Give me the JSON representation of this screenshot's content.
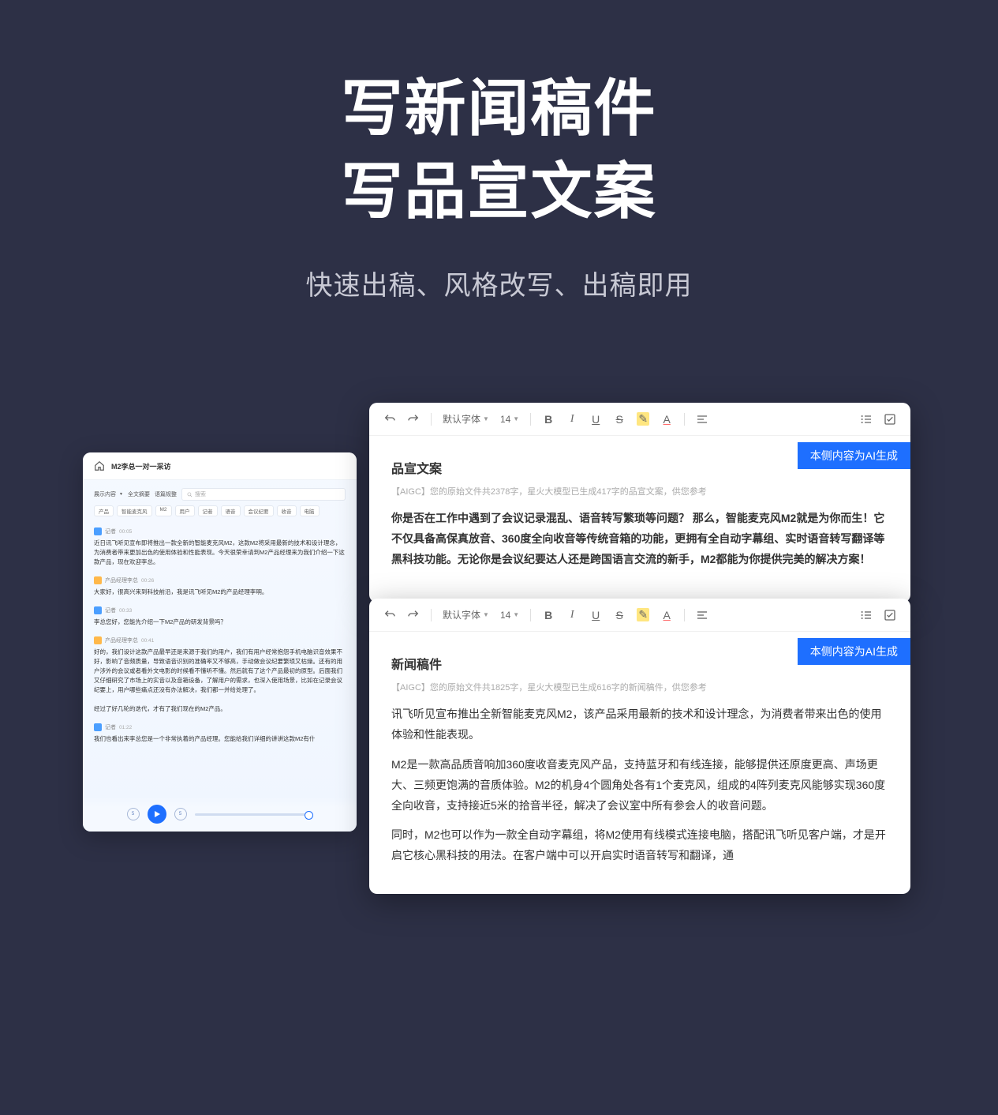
{
  "hero": {
    "title_line1": "写新闻稿件",
    "title_line2": "写品宣文案",
    "subtitle": "快速出稿、风格改写、出稿即用"
  },
  "transcript": {
    "title": "M2李总一对一采访",
    "tabs": [
      "展示内容",
      "全文摘要",
      "语篇规整"
    ],
    "search_placeholder": "搜索",
    "tags": [
      "产品",
      "智能麦克风",
      "M2",
      "用户",
      "记者",
      "语音",
      "会议纪要",
      "收音",
      "电脑"
    ],
    "messages": [
      {
        "speaker": "记者",
        "time": "00:05",
        "avatar": "a1",
        "text": "近日讯飞听见宣布即将推出一款全新的智能麦克风M2，这款M2将采用最新的技术和设计理念，为消费者带来更加出色的使用体验和性能表现。今天很荣幸请到M2产品经理来为我们介绍一下这款产品，现在欢迎李总。"
      },
      {
        "speaker": "产品经理李总",
        "time": "00:26",
        "avatar": "a2",
        "text": "大家好，很高兴来到科技前沿，我是讯飞听见M2的产品经理李明。"
      },
      {
        "speaker": "记者",
        "time": "00:33",
        "avatar": "a1",
        "text": "李总您好，您能先介绍一下M2产品的研发背景吗？"
      },
      {
        "speaker": "产品经理李总",
        "time": "00:41",
        "avatar": "a2",
        "text": "好的，我们设计这款产品最早还是来源于我们的用户，我们有用户经常抱怨手机电脑识音效果不好，影响了音频质量，导致语音识别的准确率又不够高，手动做会议纪要繁琐又枯燥。还有的用户涉外的会议或者看外文电影的时候看不懂听不懂。然后就有了这个产品最初的原型。后面我们又仔细研究了市场上的实音以及音箱设备，了解用户的需求，也深入使用场景，比如在记录会议纪要上，用户哪些痛点还没有办法解决，我们都一并给处理了。"
      },
      {
        "speaker": "",
        "time": "",
        "avatar": "",
        "text": "经过了好几轮的迭代，才有了我们现在的M2产品。"
      },
      {
        "speaker": "记者",
        "time": "01:22",
        "avatar": "a1",
        "text": "我们也看出来李总您是一个非常执着的产品经理。您能给我们详细的讲讲这款M2有什"
      }
    ],
    "skip_label": "5"
  },
  "toolbar": {
    "font": "默认字体",
    "size": "14"
  },
  "panels": [
    {
      "badge": "本侧内容为AI生成",
      "title": "品宣文案",
      "meta": "【AIGC】您的原始文件共2378字，星火大模型已生成417字的品宣文案，供您参考",
      "paragraphs": [
        {
          "bold": true,
          "text": "你是否在工作中遇到了会议记录混乱、语音转写繁琐等问题？ 那么，智能麦克风M2就是为你而生！它不仅具备高保真放音、360度全向收音等传统音箱的功能，更拥有全自动字幕组、实时语音转写翻译等黑科技功能。无论你是会议纪要达人还是跨国语言交流的新手，M2都能为你提供完美的解决方案！"
        }
      ]
    },
    {
      "badge": "本侧内容为AI生成",
      "title": "新闻稿件",
      "meta": "【AIGC】您的原始文件共1825字，星火大模型已生成616字的新闻稿件，供您参考",
      "paragraphs": [
        {
          "bold": false,
          "text": "讯飞听见宣布推出全新智能麦克风M2，该产品采用最新的技术和设计理念，为消费者带来出色的使用体验和性能表现。"
        },
        {
          "bold": false,
          "text": "M2是一款高品质音响加360度收音麦克风产品，支持蓝牙和有线连接，能够提供还原度更高、声场更大、三频更饱满的音质体验。M2的机身4个圆角处各有1个麦克风，组成的4阵列麦克风能够实现360度全向收音，支持接近5米的拾音半径，解决了会议室中所有参会人的收音问题。"
        },
        {
          "bold": false,
          "text": "同时，M2也可以作为一款全自动字幕组，将M2使用有线模式连接电脑，搭配讯飞听见客户端，才是开启它核心黑科技的用法。在客户端中可以开启实时语音转写和翻译，通"
        }
      ]
    }
  ]
}
